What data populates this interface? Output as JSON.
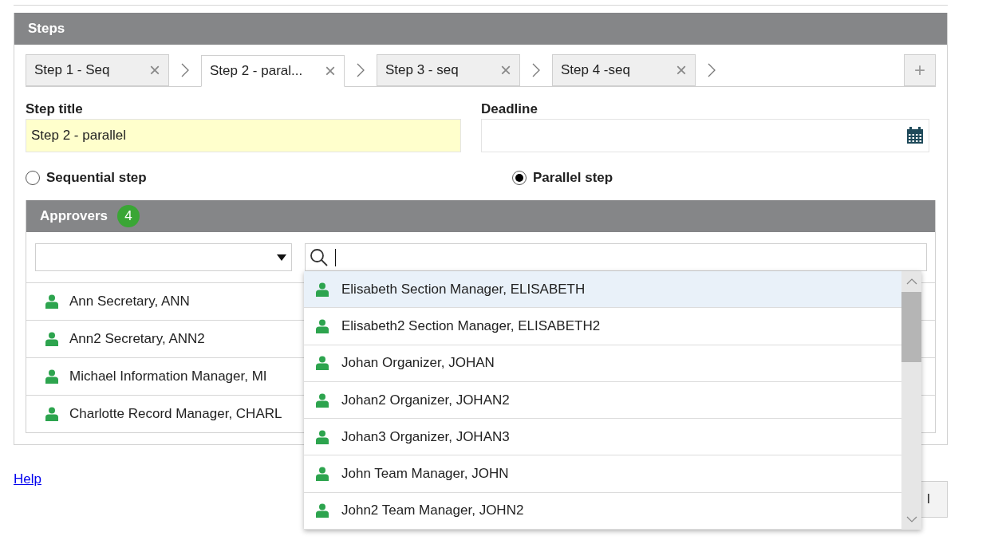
{
  "steps": {
    "title": "Steps",
    "tabs": [
      {
        "label": "Step 1 - Seq",
        "selected": false,
        "close": "×"
      },
      {
        "label": "Step 2 - paral...",
        "selected": true,
        "close": "×"
      },
      {
        "label": "Step 3 - seq",
        "selected": false,
        "close": "×"
      },
      {
        "label": "Step 4 -seq",
        "selected": false,
        "close": "×"
      }
    ],
    "add_button": "+",
    "step_title": {
      "label": "Step title",
      "value": "Step 2 - parallel"
    },
    "deadline": {
      "label": "Deadline"
    },
    "step_types": [
      {
        "label": "Sequential step",
        "checked": false
      },
      {
        "label": "Parallel step",
        "checked": true
      }
    ],
    "approvers": {
      "title": "Approvers",
      "count": "4",
      "rows": [
        {
          "name": "Ann Secretary, ANN"
        },
        {
          "name": "Ann2 Secretary, ANN2"
        },
        {
          "name": "Michael Information Manager, MI"
        },
        {
          "name": "Charlotte Record Manager, CHARL"
        }
      ]
    },
    "suggestions": [
      {
        "name": "Elisabeth Section Manager, ELISABETH",
        "selected": true
      },
      {
        "name": "Elisabeth2 Section Manager, ELISABETH2",
        "selected": false
      },
      {
        "name": "Johan Organizer, JOHAN",
        "selected": false
      },
      {
        "name": "Johan2 Organizer, JOHAN2",
        "selected": false
      },
      {
        "name": "Johan3 Organizer, JOHAN3",
        "selected": false
      },
      {
        "name": "John Team Manager, JOHN",
        "selected": false
      },
      {
        "name": "John2 Team Manager, JOHN2",
        "selected": false
      }
    ]
  },
  "help_link": "Help",
  "footer_button": "l"
}
